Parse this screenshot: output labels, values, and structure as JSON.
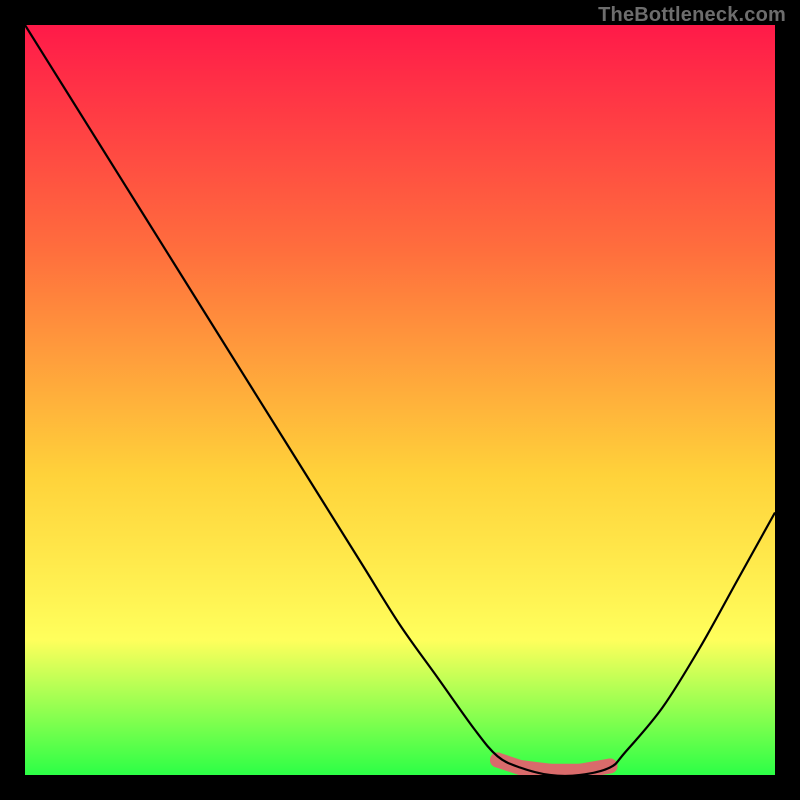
{
  "watermark": {
    "text": "TheBottleneck.com"
  },
  "colors": {
    "black": "#000000",
    "curve": "#000000",
    "marker_fill": "#d96b6b",
    "grad_top": "#ff1a49",
    "grad_mid1": "#ff6e3d",
    "grad_mid2": "#ffd23a",
    "grad_mid3": "#ffff5c",
    "grad_bottom": "#2cff46"
  },
  "chart_data": {
    "type": "line",
    "title": "",
    "xlabel": "",
    "ylabel": "",
    "xlim": [
      0,
      1
    ],
    "ylim": [
      0,
      1
    ],
    "annotations": [],
    "series": [
      {
        "name": "bottleneck-curve",
        "x": [
          0.0,
          0.05,
          0.1,
          0.15,
          0.2,
          0.25,
          0.3,
          0.35,
          0.4,
          0.45,
          0.5,
          0.55,
          0.6,
          0.63,
          0.66,
          0.7,
          0.74,
          0.78,
          0.8,
          0.85,
          0.9,
          0.95,
          1.0
        ],
        "y": [
          1.0,
          0.92,
          0.84,
          0.76,
          0.68,
          0.6,
          0.52,
          0.44,
          0.36,
          0.28,
          0.2,
          0.13,
          0.06,
          0.025,
          0.01,
          0.0,
          0.0,
          0.01,
          0.03,
          0.09,
          0.17,
          0.26,
          0.35
        ]
      }
    ],
    "markers": {
      "name": "highlight-band",
      "x": [
        0.63,
        0.66,
        0.7,
        0.74,
        0.78
      ],
      "y": [
        0.02,
        0.01,
        0.005,
        0.005,
        0.012
      ]
    },
    "gradient_stops": [
      {
        "offset": 0.0,
        "color": "#ff1a49"
      },
      {
        "offset": 0.3,
        "color": "#ff6e3d"
      },
      {
        "offset": 0.6,
        "color": "#ffd23a"
      },
      {
        "offset": 0.82,
        "color": "#ffff5c"
      },
      {
        "offset": 1.0,
        "color": "#2cff46"
      }
    ]
  }
}
